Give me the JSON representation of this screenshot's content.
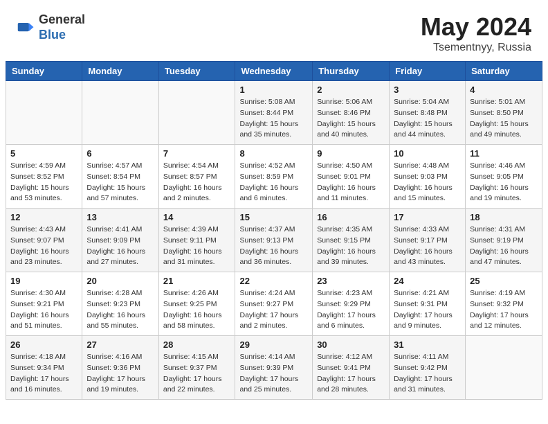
{
  "header": {
    "logo_line1": "General",
    "logo_line2": "Blue",
    "title": "May 2024",
    "location": "Tsementnyy, Russia"
  },
  "days_of_week": [
    "Sunday",
    "Monday",
    "Tuesday",
    "Wednesday",
    "Thursday",
    "Friday",
    "Saturday"
  ],
  "weeks": [
    [
      {
        "day": "",
        "info": ""
      },
      {
        "day": "",
        "info": ""
      },
      {
        "day": "",
        "info": ""
      },
      {
        "day": "1",
        "info": "Sunrise: 5:08 AM\nSunset: 8:44 PM\nDaylight: 15 hours\nand 35 minutes."
      },
      {
        "day": "2",
        "info": "Sunrise: 5:06 AM\nSunset: 8:46 PM\nDaylight: 15 hours\nand 40 minutes."
      },
      {
        "day": "3",
        "info": "Sunrise: 5:04 AM\nSunset: 8:48 PM\nDaylight: 15 hours\nand 44 minutes."
      },
      {
        "day": "4",
        "info": "Sunrise: 5:01 AM\nSunset: 8:50 PM\nDaylight: 15 hours\nand 49 minutes."
      }
    ],
    [
      {
        "day": "5",
        "info": "Sunrise: 4:59 AM\nSunset: 8:52 PM\nDaylight: 15 hours\nand 53 minutes."
      },
      {
        "day": "6",
        "info": "Sunrise: 4:57 AM\nSunset: 8:54 PM\nDaylight: 15 hours\nand 57 minutes."
      },
      {
        "day": "7",
        "info": "Sunrise: 4:54 AM\nSunset: 8:57 PM\nDaylight: 16 hours\nand 2 minutes."
      },
      {
        "day": "8",
        "info": "Sunrise: 4:52 AM\nSunset: 8:59 PM\nDaylight: 16 hours\nand 6 minutes."
      },
      {
        "day": "9",
        "info": "Sunrise: 4:50 AM\nSunset: 9:01 PM\nDaylight: 16 hours\nand 11 minutes."
      },
      {
        "day": "10",
        "info": "Sunrise: 4:48 AM\nSunset: 9:03 PM\nDaylight: 16 hours\nand 15 minutes."
      },
      {
        "day": "11",
        "info": "Sunrise: 4:46 AM\nSunset: 9:05 PM\nDaylight: 16 hours\nand 19 minutes."
      }
    ],
    [
      {
        "day": "12",
        "info": "Sunrise: 4:43 AM\nSunset: 9:07 PM\nDaylight: 16 hours\nand 23 minutes."
      },
      {
        "day": "13",
        "info": "Sunrise: 4:41 AM\nSunset: 9:09 PM\nDaylight: 16 hours\nand 27 minutes."
      },
      {
        "day": "14",
        "info": "Sunrise: 4:39 AM\nSunset: 9:11 PM\nDaylight: 16 hours\nand 31 minutes."
      },
      {
        "day": "15",
        "info": "Sunrise: 4:37 AM\nSunset: 9:13 PM\nDaylight: 16 hours\nand 36 minutes."
      },
      {
        "day": "16",
        "info": "Sunrise: 4:35 AM\nSunset: 9:15 PM\nDaylight: 16 hours\nand 39 minutes."
      },
      {
        "day": "17",
        "info": "Sunrise: 4:33 AM\nSunset: 9:17 PM\nDaylight: 16 hours\nand 43 minutes."
      },
      {
        "day": "18",
        "info": "Sunrise: 4:31 AM\nSunset: 9:19 PM\nDaylight: 16 hours\nand 47 minutes."
      }
    ],
    [
      {
        "day": "19",
        "info": "Sunrise: 4:30 AM\nSunset: 9:21 PM\nDaylight: 16 hours\nand 51 minutes."
      },
      {
        "day": "20",
        "info": "Sunrise: 4:28 AM\nSunset: 9:23 PM\nDaylight: 16 hours\nand 55 minutes."
      },
      {
        "day": "21",
        "info": "Sunrise: 4:26 AM\nSunset: 9:25 PM\nDaylight: 16 hours\nand 58 minutes."
      },
      {
        "day": "22",
        "info": "Sunrise: 4:24 AM\nSunset: 9:27 PM\nDaylight: 17 hours\nand 2 minutes."
      },
      {
        "day": "23",
        "info": "Sunrise: 4:23 AM\nSunset: 9:29 PM\nDaylight: 17 hours\nand 6 minutes."
      },
      {
        "day": "24",
        "info": "Sunrise: 4:21 AM\nSunset: 9:31 PM\nDaylight: 17 hours\nand 9 minutes."
      },
      {
        "day": "25",
        "info": "Sunrise: 4:19 AM\nSunset: 9:32 PM\nDaylight: 17 hours\nand 12 minutes."
      }
    ],
    [
      {
        "day": "26",
        "info": "Sunrise: 4:18 AM\nSunset: 9:34 PM\nDaylight: 17 hours\nand 16 minutes."
      },
      {
        "day": "27",
        "info": "Sunrise: 4:16 AM\nSunset: 9:36 PM\nDaylight: 17 hours\nand 19 minutes."
      },
      {
        "day": "28",
        "info": "Sunrise: 4:15 AM\nSunset: 9:37 PM\nDaylight: 17 hours\nand 22 minutes."
      },
      {
        "day": "29",
        "info": "Sunrise: 4:14 AM\nSunset: 9:39 PM\nDaylight: 17 hours\nand 25 minutes."
      },
      {
        "day": "30",
        "info": "Sunrise: 4:12 AM\nSunset: 9:41 PM\nDaylight: 17 hours\nand 28 minutes."
      },
      {
        "day": "31",
        "info": "Sunrise: 4:11 AM\nSunset: 9:42 PM\nDaylight: 17 hours\nand 31 minutes."
      },
      {
        "day": "",
        "info": ""
      }
    ]
  ]
}
